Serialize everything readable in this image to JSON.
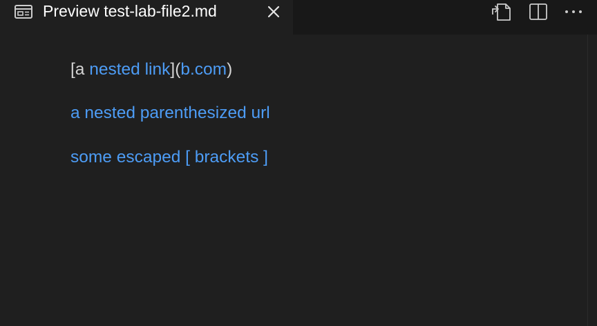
{
  "tab": {
    "title": "Preview test-lab-file2.md",
    "icon": "preview-icon",
    "close_icon": "close-icon"
  },
  "actions": [
    {
      "name": "open-source-icon"
    },
    {
      "name": "split-editor-icon"
    },
    {
      "name": "more-actions-icon"
    }
  ],
  "content": {
    "line1": {
      "open_bracket": "[a ",
      "link1": "nested link",
      "mid": "](",
      "link2": "b.com",
      "close": ")"
    },
    "line2": "a nested parenthesized url",
    "line3": "some escaped [ brackets ]"
  },
  "colors": {
    "background": "#1f1f1f",
    "tabbar": "#181818",
    "link": "#4d9cf5",
    "text": "#d4d4d4"
  }
}
